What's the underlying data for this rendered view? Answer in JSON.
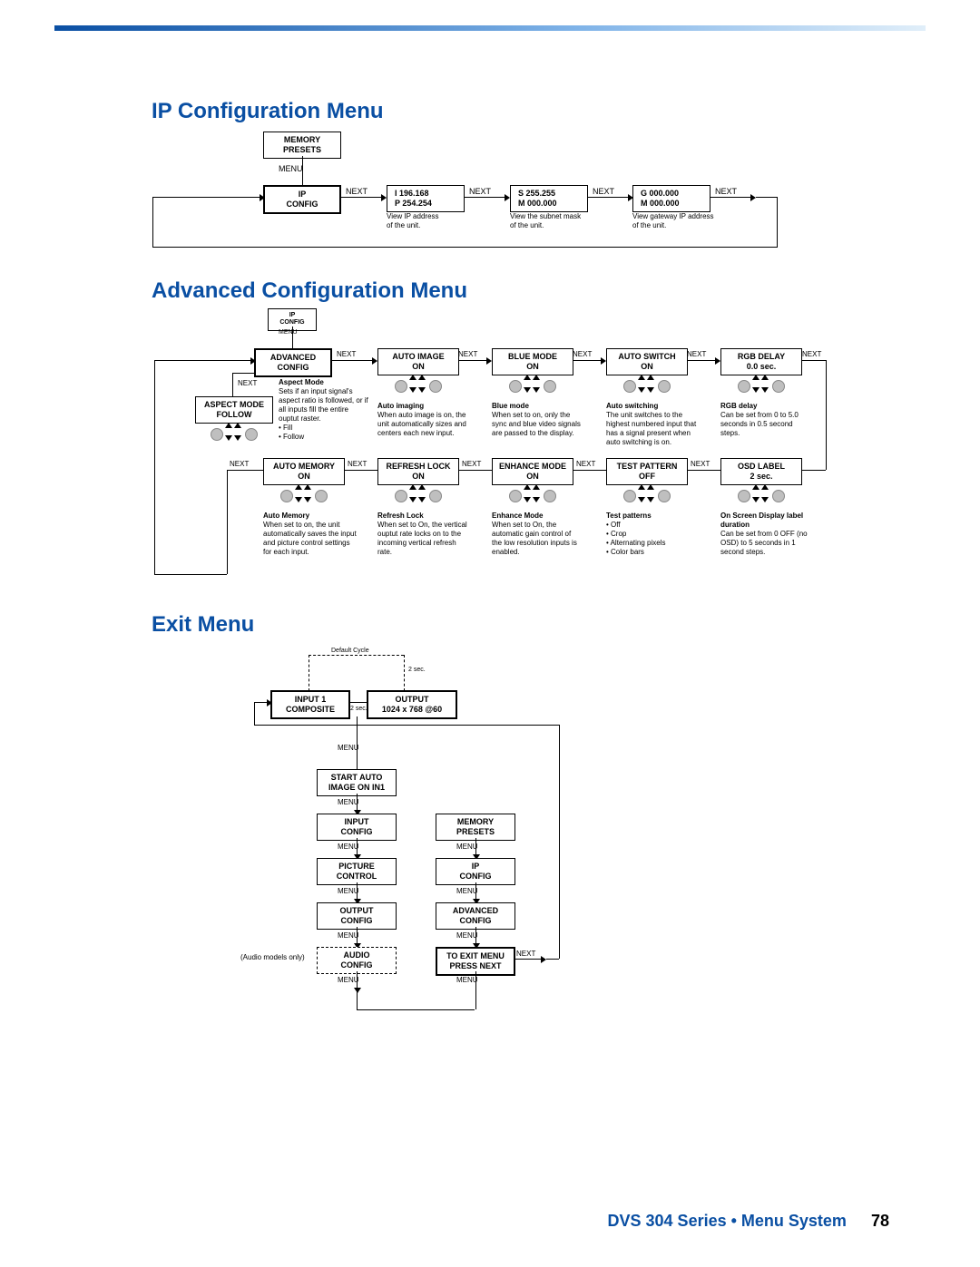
{
  "footer": {
    "title": "DVS 304 Series • Menu System",
    "page": "78"
  },
  "sections": {
    "ip": "IP Configuration Menu",
    "adv": "Advanced Configuration Menu",
    "exit": "Exit Menu"
  },
  "ip": {
    "memory_presets": "MEMORY\nPRESETS",
    "menu_lbl": "MENU",
    "ip_config": "IP\nCONFIG",
    "next_lbl": "NEXT",
    "col1": {
      "box": "I   196.168\nP  254.254",
      "desc": "View IP address\nof the unit."
    },
    "col2": {
      "box": "S  255.255\nM 000.000",
      "desc": "View the subnet mask\nof the unit."
    },
    "col3": {
      "box": "G  000.000\nM 000.000",
      "desc": "View gateway IP address\nof the unit."
    }
  },
  "adv": {
    "ip_config": "IP\nCONFIG",
    "menu_lbl": "MENU",
    "adv_config": "ADVANCED\nCONFIG",
    "next_lbl": "NEXT",
    "aspect_box": "ASPECT MODE\nFOLLOW",
    "aspect_desc_title": "Aspect Mode",
    "aspect_desc": "Sets if an input signal's aspect ratio is followed, or if all inputs fill the entire ouptut raster.\n• Fill\n• Follow",
    "row1": {
      "auto_image": {
        "box": "AUTO IMAGE\n<OFF>    ON",
        "title": "Auto imaging",
        "desc": "When auto image is on, the unit automatically sizes and centers each new input."
      },
      "blue_mode": {
        "box": "BLUE MODE\n<OFF>    ON",
        "title": "Blue mode",
        "desc": "When set to on, only the sync and blue video signals are passed to the display."
      },
      "auto_switch": {
        "box": "AUTO SWITCH\n<OFF>    ON",
        "title": "Auto switching",
        "desc": "The unit switches to the highest numbered input that has a signal present when auto switching is on."
      },
      "rgb_delay": {
        "box": "RGB DELAY\n0.0 sec.",
        "title": "RGB delay",
        "desc": "Can be set from 0 to 5.0 seconds in 0.5 second steps."
      }
    },
    "row2": {
      "auto_memory": {
        "box": "AUTO MEMORY\n<OFF>    ON",
        "title": "Auto Memory",
        "desc": "When set to on, the unit automatically saves the input and picture control settings for each input."
      },
      "refresh_lock": {
        "box": "REFRESH LOCK\n<OFF>    ON",
        "title": "Refresh Lock",
        "desc": "When set to On, the vertical ouptut rate locks on to the incoming vertical refresh rate."
      },
      "enhance_mode": {
        "box": "ENHANCE MODE\n<OFF>    ON",
        "title": "Enhance Mode",
        "desc": "When set to On, the automatic gain control of the low resolution inputs is enabled."
      },
      "test_pattern": {
        "box": "TEST PATTERN\nOFF",
        "title": "Test patterns",
        "desc": "• Off\n• Crop\n• Alternating pixels\n• Color bars"
      },
      "osd_label": {
        "box": "OSD LABEL\n2 sec.",
        "title": "On Screen Display label duration",
        "desc": "Can be set from 0 OFF (no OSD) to 5 seconds in 1 second steps."
      }
    }
  },
  "exit": {
    "default_cycle": "Default Cycle",
    "two_sec": "2 sec.",
    "input1": "INPUT 1\nCOMPOSITE",
    "output": "OUTPUT\n1024 x 768 @60",
    "menu_lbl": "MENU",
    "next_lbl": "NEXT",
    "start_auto": "START AUTO\nIMAGE ON IN1",
    "input_config": "INPUT\nCONFIG",
    "picture_control": "PICTURE\nCONTROL",
    "output_config": "OUTPUT\nCONFIG",
    "audio_config": "AUDIO\nCONFIG",
    "audio_note": "(Audio models only)",
    "memory_presets": "MEMORY\nPRESETS",
    "ip_config": "IP\nCONFIG",
    "adv_config": "ADVANCED\nCONFIG",
    "to_exit": "TO EXIT MENU\nPRESS NEXT"
  }
}
